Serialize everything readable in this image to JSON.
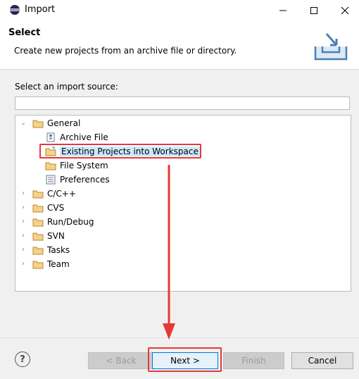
{
  "window": {
    "title": "Import"
  },
  "banner": {
    "title": "Select",
    "description": "Create new projects from an archive file or directory."
  },
  "source": {
    "label": "Select an import source:",
    "filter_value": "",
    "filter_placeholder": ""
  },
  "tree": {
    "items": [
      {
        "label": "General",
        "expanded": true,
        "icon": "folder-icon"
      },
      {
        "label": "Archive File",
        "icon": "archive-file-icon"
      },
      {
        "label": "Existing Projects into Workspace",
        "icon": "project-folder-icon",
        "selected": true
      },
      {
        "label": "File System",
        "icon": "folder-icon"
      },
      {
        "label": "Preferences",
        "icon": "preferences-icon"
      },
      {
        "label": "C/C++",
        "icon": "folder-icon"
      },
      {
        "label": "CVS",
        "icon": "folder-icon"
      },
      {
        "label": "Run/Debug",
        "icon": "folder-icon"
      },
      {
        "label": "SVN",
        "icon": "folder-icon"
      },
      {
        "label": "Tasks",
        "icon": "folder-icon"
      },
      {
        "label": "Team",
        "icon": "folder-icon"
      }
    ]
  },
  "buttons": {
    "help": "?",
    "back": "< Back",
    "next": "Next >",
    "finish": "Finish",
    "cancel": "Cancel"
  },
  "colors": {
    "annotation": "#e53935",
    "selection": "#cce8ff",
    "folder": "#e8b64c"
  }
}
